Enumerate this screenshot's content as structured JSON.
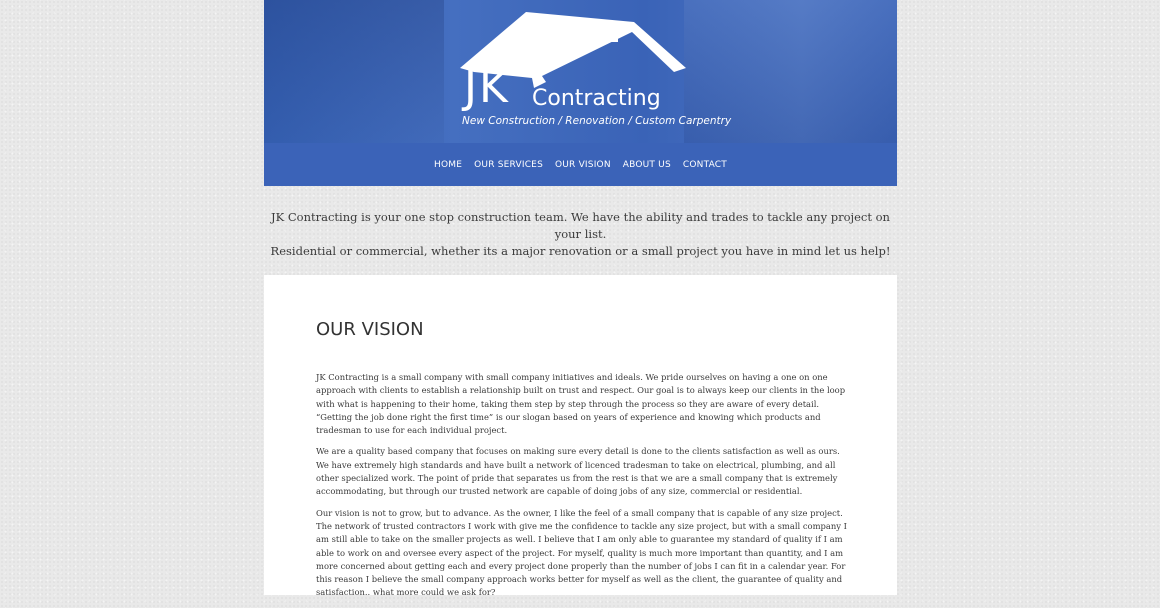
{
  "header": {
    "logo_initials": "JK",
    "logo_name": "Contracting",
    "tagline": "New Construction / Renovation / Custom Carpentry"
  },
  "nav": {
    "items": [
      "HOME",
      "OUR SERVICES",
      "OUR VISION",
      "ABOUT US",
      "CONTACT"
    ]
  },
  "intro": {
    "line1": "JK Contracting is your one stop construction team. We have the ability and trades to tackle any project on your list.",
    "line2": "Residential or commercial, whether its a major renovation or a small project you have in mind let us help!"
  },
  "content": {
    "title": "OUR VISION",
    "paragraphs": [
      "JK Contracting is a small company with small company initiatives and ideals. We pride ourselves on having a one on one approach with clients to establish a relationship built on trust and respect. Our goal is to always keep our clients in the loop with what is happening to their home, taking them step by step through the process so they are aware of every detail. “Getting the job done right the first time” is our slogan based on years of experience and knowing which products and tradesman to use for each individual project.",
      "We are a quality based company that focuses on making sure every detail is done to the clients satisfaction as well as ours. We have extremely high standards and have built a network of licenced tradesman to take on electrical, plumbing, and all other specialized work. The point of pride that separates us from the rest is that we are a small company that is extremely accommodating, but through our trusted network are capable of doing jobs of any size, commercial or residential.",
      "Our vision is not to grow, but to advance. As the owner, I like the feel of a small company that is capable of any size project. The network of trusted contractors I work with give me the confidence to tackle any size project, but with a small company I am still able to take on the smaller projects as well. I believe that I am only able to guarantee my standard of quality if I am able to work on and oversee every aspect of the project. For myself, quality is much more important than quantity, and I am more concerned about getting each and every project done properly than the number of jobs I can fit in a calendar year. For this reason I believe the small company approach works better for myself as well as the client, the guarantee of quality and satisfaction.. what more could we ask for?"
    ]
  },
  "colors": {
    "header_blue": "#3b63b8",
    "page_bg": "#e9e9e9"
  }
}
